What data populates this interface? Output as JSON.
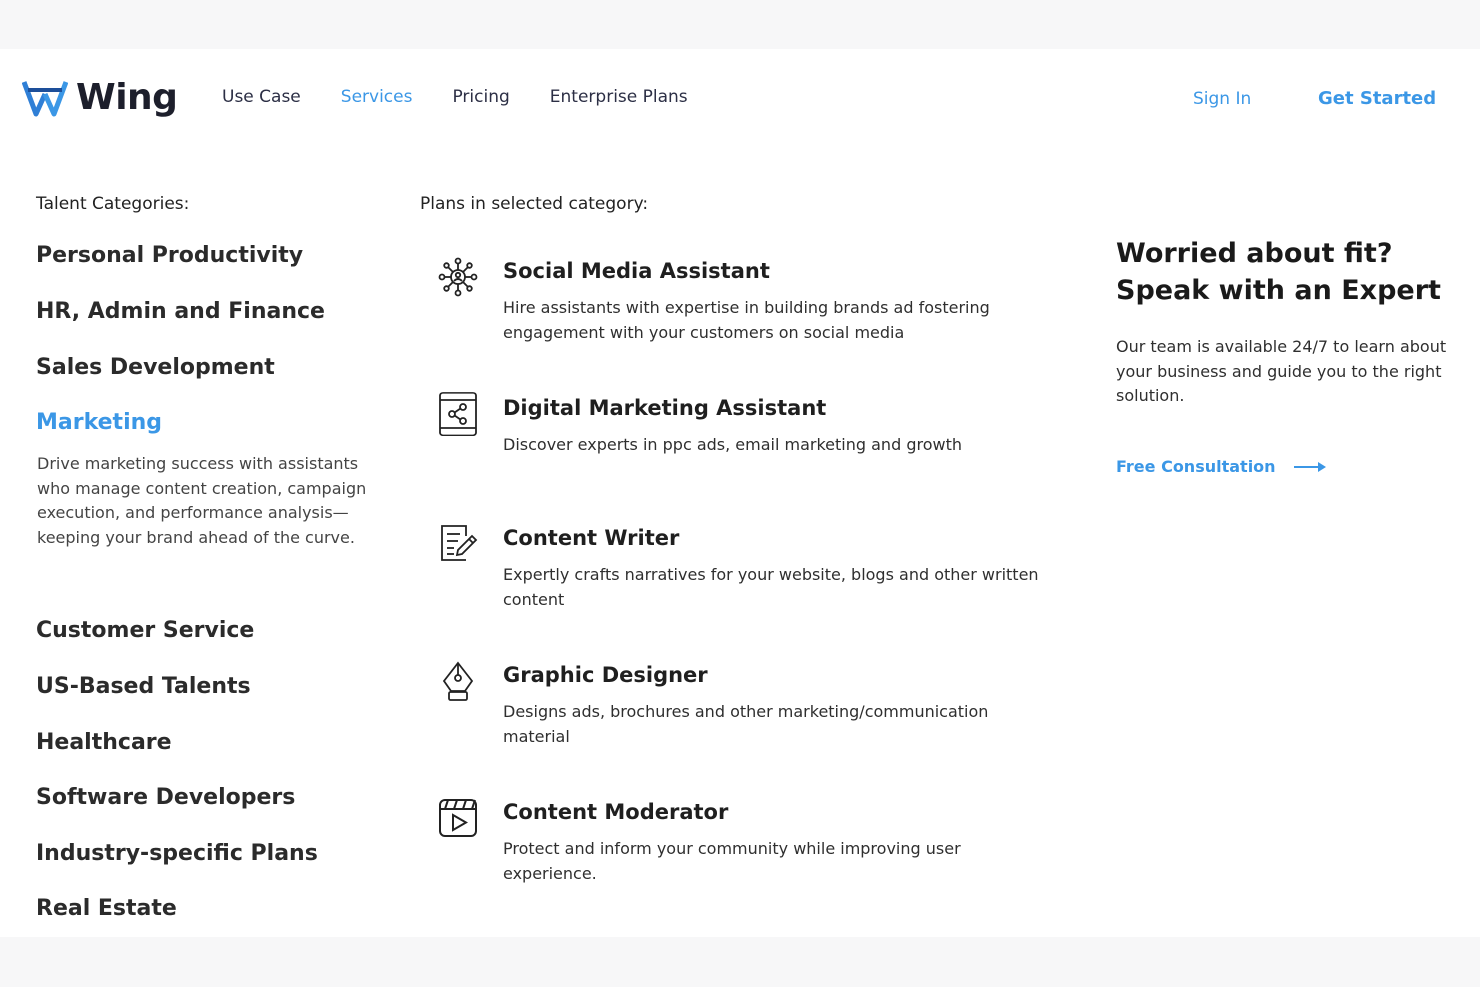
{
  "header": {
    "logo_text": "Wing",
    "nav": [
      "Use Case",
      "Services",
      "Pricing",
      "Enterprise Plans"
    ],
    "active_nav": "Services",
    "sign_in": "Sign In",
    "get_started": "Get Started"
  },
  "left": {
    "label": "Talent Categories:",
    "categories": [
      "Personal Productivity",
      "HR, Admin and Finance",
      "Sales Development",
      "Marketing",
      "Customer Service",
      "US-Based Talents",
      "Healthcare",
      "Software Developers",
      "Industry-specific Plans",
      "Real Estate"
    ],
    "active_category": "Marketing",
    "active_description": "Drive marketing success with assistants who manage content creation, campaign execution, and performance analysis—keeping your brand ahead of the curve."
  },
  "plans": {
    "label": "Plans in selected category:",
    "items": [
      {
        "icon": "social-network-icon",
        "title": "Social Media Assistant",
        "description": "Hire assistants with expertise in building brands ad fostering engagement with your customers on social media"
      },
      {
        "icon": "tablet-share-icon",
        "title": "Digital Marketing Assistant",
        "description": "Discover experts in ppc ads, email marketing and growth"
      },
      {
        "icon": "document-edit-icon",
        "title": "Content Writer",
        "description": "Expertly crafts narratives for your website, blogs and other written content"
      },
      {
        "icon": "pen-nib-icon",
        "title": "Graphic Designer",
        "description": "Designs ads, brochures and other marketing/communication material"
      },
      {
        "icon": "video-clapper-icon",
        "title": "Content Moderator",
        "description": "Protect and inform your community while improving user experience."
      }
    ]
  },
  "cta": {
    "title": "Worried about fit? Speak with an Expert",
    "text": "Our team is available 24/7 to learn about your business and guide you to the right solution.",
    "link": "Free Consultation"
  },
  "colors": {
    "accent": "#3b97e6",
    "text": "#1f1f1f",
    "page_bg": "#ffffff",
    "outer_bg": "#f7f7f8"
  }
}
